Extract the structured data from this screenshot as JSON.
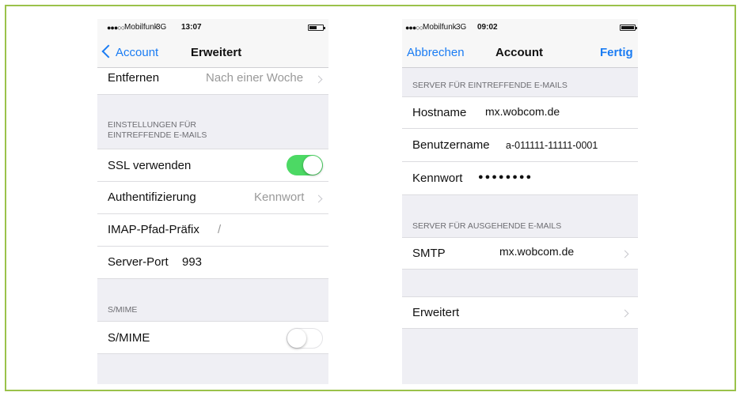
{
  "colors": {
    "accent": "#1a7cf3",
    "toggle_on": "#4cd964",
    "frame_border": "#9bc24a"
  },
  "left_screen": {
    "status": {
      "signal": "●●●○○",
      "carrier": "Mobilfunk",
      "network": "3G",
      "time": "13:07"
    },
    "nav": {
      "back_label": "Account",
      "title": "Erweitert"
    },
    "rows": {
      "entfernen": {
        "label": "Entfernen",
        "value": "Nach einer Woche"
      },
      "section_incoming_line1": "EINSTELLUNGEN FÜR",
      "section_incoming_line2": "EINTREFFENDE E-MAILS",
      "ssl": {
        "label": "SSL verwenden",
        "enabled": true
      },
      "auth": {
        "label": "Authentifizierung",
        "value": "Kennwort"
      },
      "imap": {
        "label": "IMAP-Pfad-Präfix",
        "value": "/"
      },
      "port": {
        "label": "Server-Port",
        "value": "993"
      },
      "section_smime": "S/MIME",
      "smime": {
        "label": "S/MIME",
        "enabled": false
      }
    }
  },
  "right_screen": {
    "status": {
      "signal": "●●●○○",
      "carrier": "Mobilfunk",
      "network": "3G",
      "time": "09:02"
    },
    "nav": {
      "cancel_label": "Abbrechen",
      "title": "Account",
      "done_label": "Fertig"
    },
    "section_incoming": "SERVER FÜR EINTREFFENDE E-MAILS",
    "hostname": {
      "label": "Hostname",
      "value": "mx.wobcom.de"
    },
    "username": {
      "label": "Benutzername",
      "value": "a-011111-11111-0001"
    },
    "password": {
      "label": "Kennwort",
      "value": "●●●●●●●●"
    },
    "section_outgoing": "SERVER FÜR AUSGEHENDE E-MAILS",
    "smtp": {
      "label": "SMTP",
      "value": "mx.wobcom.de"
    },
    "advanced": {
      "label": "Erweitert"
    }
  }
}
